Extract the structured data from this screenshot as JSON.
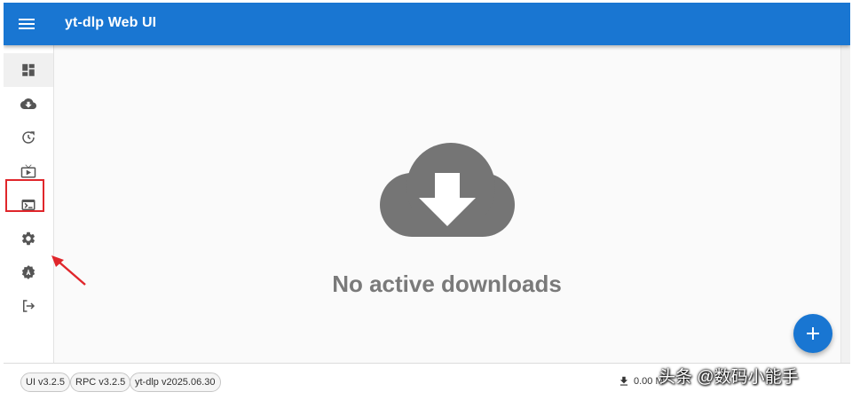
{
  "app": {
    "title": "yt-dlp Web UI",
    "accent_color": "#1976d2"
  },
  "appbar": {
    "menu_icon": "hamburger-menu-icon"
  },
  "sidebar": {
    "items": [
      {
        "icon": "dashboard-icon",
        "selected": true
      },
      {
        "icon": "cloud-download-icon",
        "selected": false
      },
      {
        "icon": "history-icon",
        "selected": false
      },
      {
        "icon": "live-tv-icon",
        "selected": false
      },
      {
        "icon": "terminal-icon",
        "selected": false
      },
      {
        "icon": "settings-gear-icon",
        "selected": false,
        "highlighted": true
      },
      {
        "icon": "admin-settings-icon",
        "selected": false
      },
      {
        "icon": "logout-icon",
        "selected": false
      }
    ],
    "highlight_color": "#e0262b"
  },
  "main": {
    "empty_icon": "cloud-download-icon",
    "empty_text": "No active downloads"
  },
  "fab": {
    "icon": "plus-icon"
  },
  "footer": {
    "chips": [
      "UI v3.2.5",
      "RPC v3.2.5",
      "yt-dlp v2025.06.30"
    ],
    "speed_icon": "download-icon",
    "speed_text": "0.00 M"
  },
  "watermark": {
    "text": "头条 @数码小能手"
  }
}
